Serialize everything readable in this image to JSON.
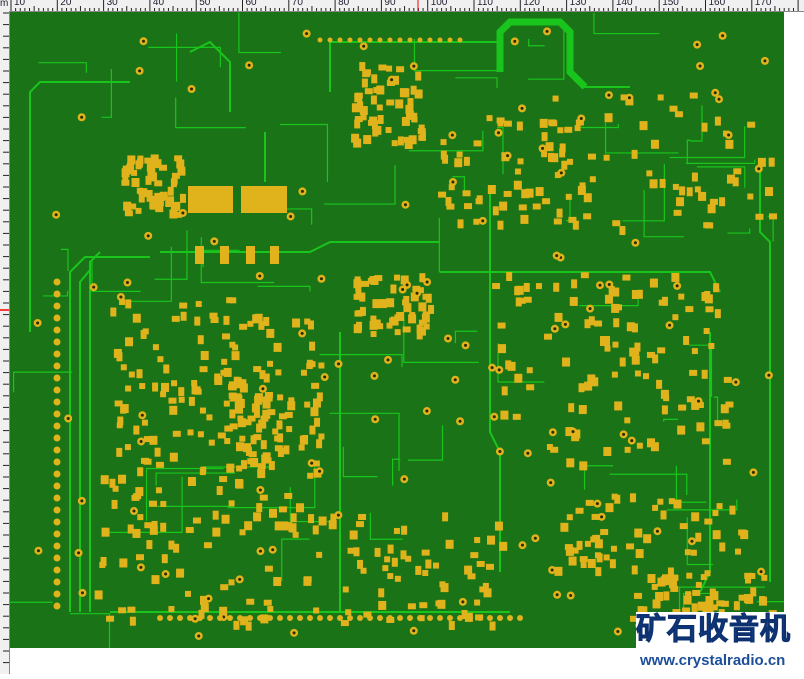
{
  "ruler": {
    "unit_label": "m",
    "ticks": [
      "10",
      "20",
      "30",
      "40",
      "50",
      "60",
      "70",
      "80",
      "90",
      "100",
      "110",
      "120",
      "130",
      "140",
      "150",
      "160",
      "170"
    ],
    "cursor_marker_color": "#ff0000"
  },
  "board": {
    "substrate_color": "#1b7318",
    "trace_color": "#19c41d",
    "pad_color": "#e0b21c",
    "hole_color": "#2a2a00"
  },
  "watermark": {
    "title": "矿石收音机",
    "url": "www.crystalradio.cn"
  }
}
